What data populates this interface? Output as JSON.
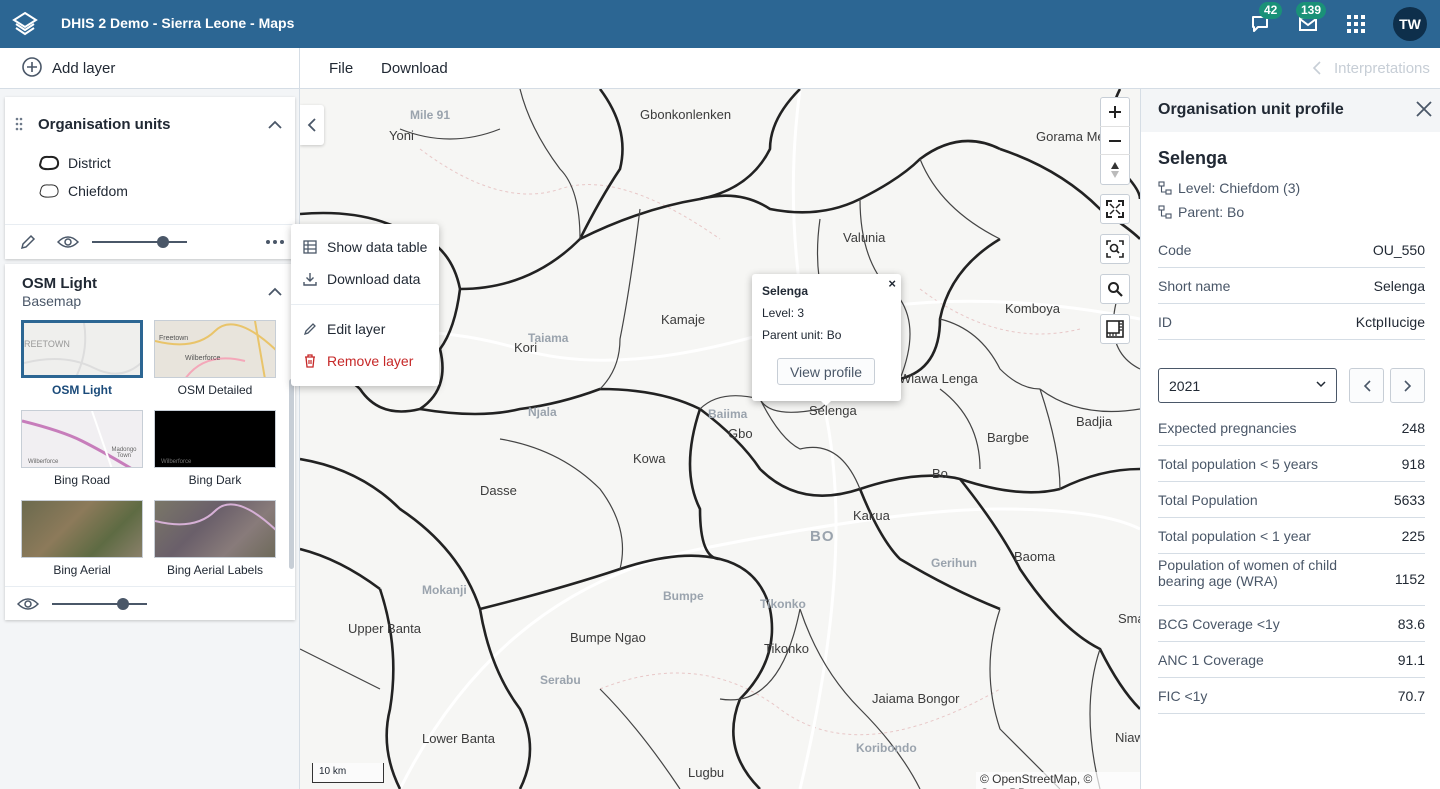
{
  "header": {
    "title": "DHIS 2 Demo - Sierra Leone - Maps",
    "messages_count": "42",
    "inbox_count": "139",
    "user_initials": "TW",
    "bg_color": "#2c6693"
  },
  "toolbar": {
    "add_layer": "Add layer",
    "file": "File",
    "download": "Download",
    "interpretations": "Interpretations"
  },
  "layers": {
    "org_units": {
      "title": "Organisation units",
      "legend": [
        "District",
        "Chiefdom"
      ]
    },
    "basemap": {
      "title": "OSM Light",
      "subtitle": "Basemap",
      "options": [
        {
          "label": "OSM Light",
          "selected": true
        },
        {
          "label": "OSM Detailed",
          "selected": false
        },
        {
          "label": "Bing Road",
          "selected": false
        },
        {
          "label": "Bing Dark",
          "selected": false
        },
        {
          "label": "Bing Aerial",
          "selected": false
        },
        {
          "label": "Bing Aerial Labels",
          "selected": false
        }
      ],
      "thumb_texts": [
        "REETOWN",
        "Freetown",
        "Wilberforce",
        "Madongo Town",
        "Wilberforce",
        "Wilberforce"
      ]
    },
    "org_units_opacity": 0.75,
    "basemap_opacity": 0.75
  },
  "context_menu": {
    "show_data_table": "Show data table",
    "download_data": "Download data",
    "edit_layer": "Edit layer",
    "remove_layer": "Remove layer"
  },
  "map": {
    "places": [
      "Mile 91",
      "Yoni",
      "Gbonkonlenken",
      "Gorama Me",
      "Valunia",
      "Kamaje",
      "Komboya",
      "Kori",
      "Taiama",
      "Njala",
      "Baiima",
      "Gbo",
      "Selenga",
      "Wiawa Lenga",
      "Bargbe",
      "Badjia",
      "Kowa",
      "Bo",
      "Dasse",
      "Kakua",
      "BO",
      "Gerihun",
      "Baoma",
      "Mokanji",
      "Bumpe",
      "Tikonko",
      "Upper Banta",
      "Bumpe Ngao",
      "Tikonko",
      "Serabu",
      "Jaiama Bongor",
      "Sma",
      "Lower Banta",
      "Koribondo",
      "Niaw",
      "Lugbu"
    ],
    "scale": "10 km",
    "attribution": "© OpenStreetMap, © CartoDB"
  },
  "popup": {
    "title": "Selenga",
    "level": "Level: 3",
    "parent": "Parent unit: Bo",
    "button": "View profile",
    "close": "×"
  },
  "profile": {
    "title": "Organisation unit profile",
    "name": "Selenga",
    "level": "Level: Chiefdom (3)",
    "parent": "Parent: Bo",
    "attributes": [
      {
        "k": "Code",
        "v": "OU_550"
      },
      {
        "k": "Short name",
        "v": "Selenga"
      },
      {
        "k": "ID",
        "v": "KctpIIucige"
      }
    ],
    "year": "2021",
    "data": [
      {
        "k": "Expected pregnancies",
        "v": "248"
      },
      {
        "k": "Total population < 5 years",
        "v": "918"
      },
      {
        "k": "Total Population",
        "v": "5633"
      },
      {
        "k": "Total population < 1 year",
        "v": "225"
      },
      {
        "k": "Population of women of child bearing age (WRA)",
        "v": "1152"
      },
      {
        "k": "BCG Coverage <1y",
        "v": "83.6"
      },
      {
        "k": "ANC 1 Coverage",
        "v": "91.1"
      },
      {
        "k": "FIC <1y",
        "v": "70.7"
      }
    ]
  }
}
